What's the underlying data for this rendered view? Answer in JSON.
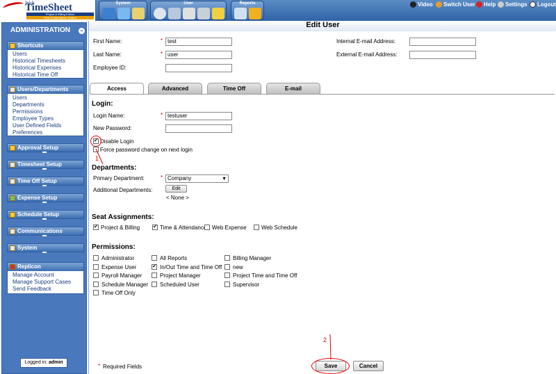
{
  "logo": {
    "web": "Web",
    "name": "TimeSheet",
    "edition1": "Project & Billing Edition",
    "edition2": "Time & Attendance Edition"
  },
  "modules": [
    {
      "label": "System"
    },
    {
      "label": "User"
    },
    {
      "label": "Reports"
    }
  ],
  "toplinks": {
    "video": "Video",
    "switch_user": "Switch User",
    "help": "Help",
    "settings": "Settings",
    "logout": "Logout"
  },
  "sidebar": {
    "title": "ADMINISTRATION",
    "shortcuts": {
      "title": "Shortcuts",
      "items": [
        "Users",
        "Historical Timesheets",
        "Historical Expenses",
        "Historical Time Off"
      ]
    },
    "users_departments": {
      "title": "Users/Departments",
      "items": [
        "Users",
        "Departments",
        "Permissions",
        "Employee Types",
        "User Defined Fields",
        "Preferences"
      ]
    },
    "sections": [
      "Approval Setup",
      "Timesheet Setup",
      "Time Off Setup",
      "Expense Setup",
      "Schedule Setup",
      "Communications",
      "System"
    ],
    "replicon": {
      "title": "Replicon",
      "items": [
        "Manage Account",
        "Manage Support Cases",
        "Send Feedback"
      ]
    },
    "logged_in_label": "Logged in:",
    "logged_in_user": "admin"
  },
  "page": {
    "title": "Edit User",
    "first_name_label": "First Name:",
    "first_name": "test",
    "last_name_label": "Last Name:",
    "last_name": "user",
    "employee_id_label": "Employee ID:",
    "employee_id": "",
    "internal_email_label": "Internal E-mail Address:",
    "internal_email": "",
    "external_email_label": "External E-mail Address:",
    "external_email": "",
    "required_star": "*"
  },
  "tabs": [
    "Access",
    "Advanced",
    "Time Off",
    "E-mail"
  ],
  "login": {
    "heading": "Login:",
    "login_name_label": "Login Name:",
    "login_name": "testuser",
    "new_password_label": "New Password:",
    "new_password": "",
    "disable_login": "Disable Login",
    "disable_login_checked": true,
    "force_pw": "Force password change on next login",
    "force_pw_checked": false
  },
  "departments": {
    "heading": "Departments:",
    "primary_label": "Primary Department:",
    "primary_value": "Company",
    "additional_label": "Additional Departments:",
    "edit_button": "Edit",
    "none_text": "< None >"
  },
  "seats": {
    "heading": "Seat Assignments:",
    "items": [
      {
        "label": "Project & Billing",
        "checked": true
      },
      {
        "label": "Time & Attendance",
        "checked": true
      },
      {
        "label": "Web Expense",
        "checked": false
      },
      {
        "label": "Web Schedule",
        "checked": false
      }
    ]
  },
  "permissions": {
    "heading": "Permissions:",
    "col1": [
      {
        "label": "Administrator",
        "checked": false
      },
      {
        "label": "Expense User",
        "checked": false
      },
      {
        "label": "Payroll Manager",
        "checked": false
      },
      {
        "label": "Schedule Manager",
        "checked": false
      },
      {
        "label": "Time Off Only",
        "checked": false
      }
    ],
    "col2": [
      {
        "label": "All Reports",
        "checked": false
      },
      {
        "label": "In/Out Time and Time Off",
        "checked": true
      },
      {
        "label": "Project Manager",
        "checked": false
      },
      {
        "label": "Scheduled User",
        "checked": false
      }
    ],
    "col3": [
      {
        "label": "Billing Manager",
        "checked": false
      },
      {
        "label": "new",
        "checked": false
      },
      {
        "label": "Project Time and Time Off",
        "checked": false
      },
      {
        "label": "Supervisor",
        "checked": false
      }
    ]
  },
  "footer": {
    "required_note": "Required Fields",
    "save": "Save",
    "cancel": "Cancel"
  },
  "annotations": {
    "one": "1",
    "two": "2"
  },
  "colors": {
    "accent": "#4a78bd",
    "annotation": "#dd0000"
  }
}
